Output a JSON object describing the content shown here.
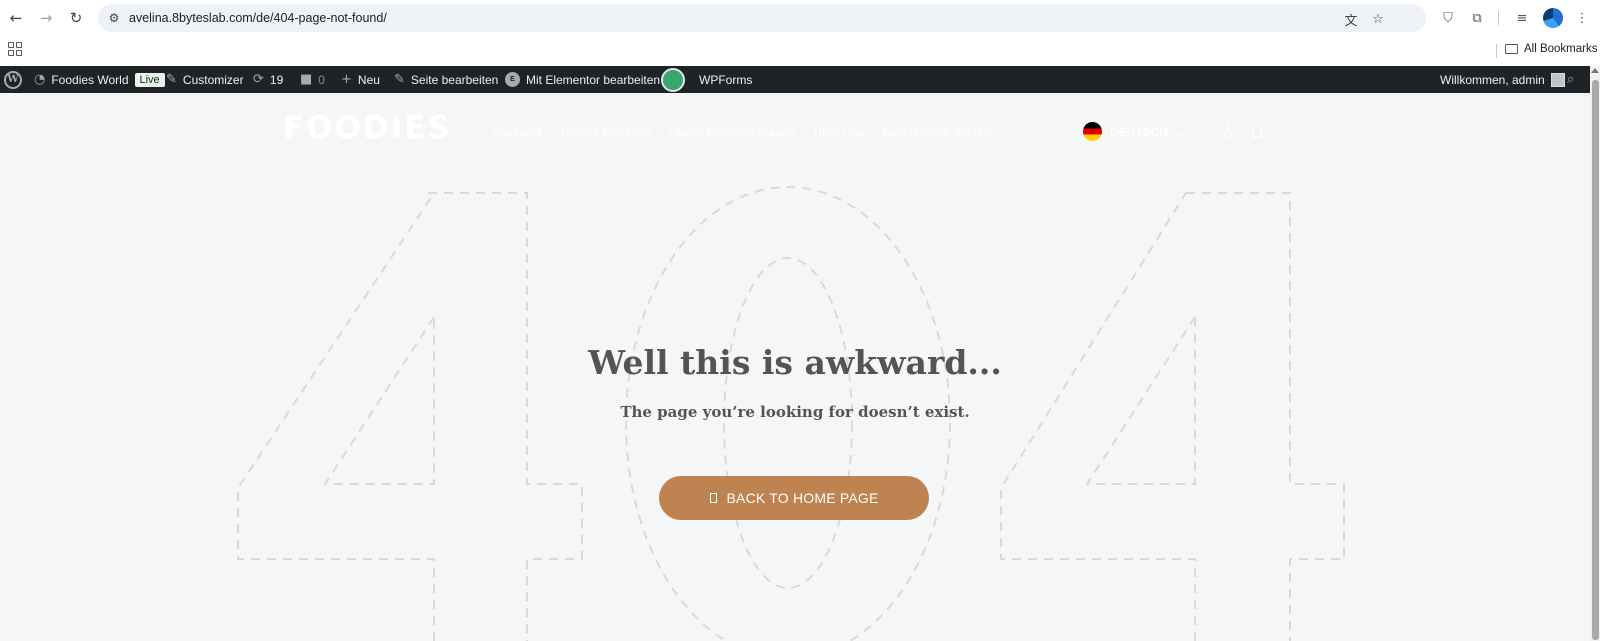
{
  "browser": {
    "url": "avelina.8byteslab.com/de/404-page-not-found/",
    "all_bookmarks": "All Bookmarks"
  },
  "wp_admin": {
    "site_name": "Foodies World",
    "live_badge": "Live",
    "customizer": "Customizer",
    "updates_count": "19",
    "comments_count": "0",
    "new_label": "Neu",
    "edit_page": "Seite bearbeiten",
    "elementor_edit": "Mit Elementor bearbeiten",
    "wpforms": "WPForms",
    "welcome": "Willkommen, admin"
  },
  "site": {
    "logo": "FOODIES",
    "nav": [
      "Startseite",
      "Unsere Produkte",
      "Häufig Gestellte Fragen",
      "Über Uns",
      "Kontaktieren Sie uns"
    ],
    "language": "DEUTSCH",
    "cart_count": "0"
  },
  "error_page": {
    "background_number": "404",
    "title": "Well this is awkward...",
    "subtitle": "The page you’re looking for doesn’t exist.",
    "button_label": "BACK TO HOME PAGE"
  },
  "colors": {
    "button": "#be8350",
    "admin_bar": "#1d2327",
    "page_bg": "#f5f6f8",
    "text": "#525456"
  }
}
